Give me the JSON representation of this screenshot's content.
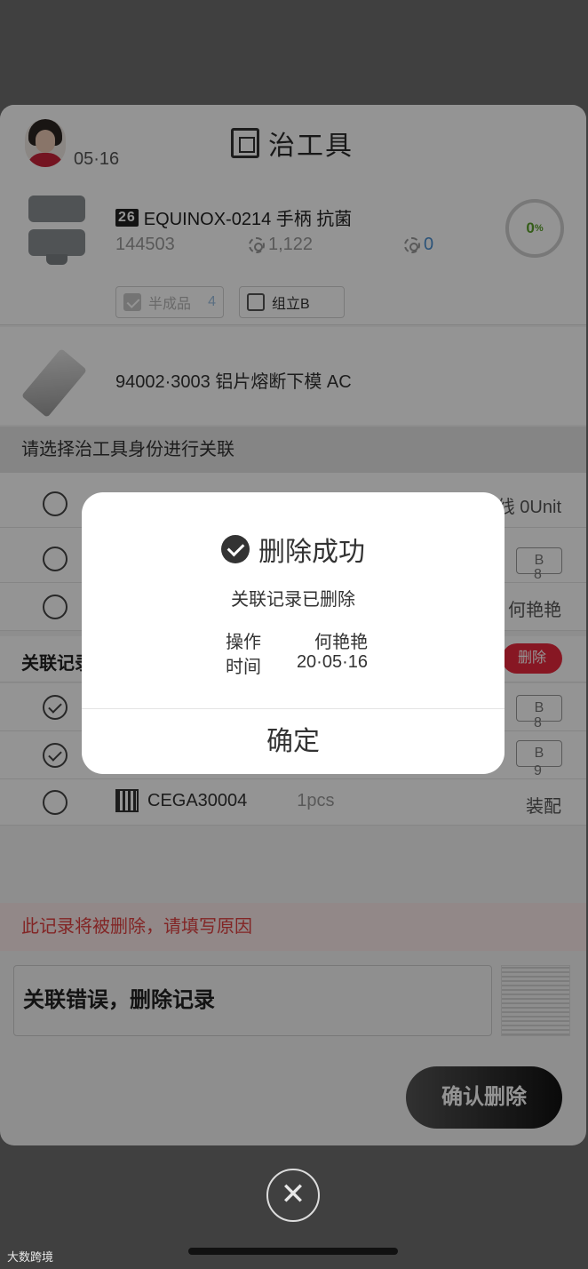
{
  "header": {
    "date": "05·16",
    "title": "治工具"
  },
  "product": {
    "code_badge": "26",
    "name": "EQUINOX-0214 手柄 抗菌",
    "id": "144503",
    "count_a": "1,122",
    "count_b": "0",
    "progress": "0",
    "progress_unit": "%",
    "tags": [
      {
        "label": "半成品",
        "count": "4",
        "checked": true
      },
      {
        "label": "组立B",
        "checked": false
      }
    ]
  },
  "tool": {
    "name": "94002·3003 铝片熔断下模 AC"
  },
  "select_section": {
    "title": "请选择治工具身份进行关联",
    "rows": [
      {
        "right": "线 0Unit"
      },
      {
        "tag": "B",
        "sub": "8"
      },
      {
        "right": "何艳艳"
      }
    ]
  },
  "linked_section": {
    "title": "关联记录",
    "delete_label": "删除",
    "rows": [
      {
        "tag": "B",
        "sub": "8",
        "checked": true
      },
      {
        "tag": "B",
        "sub": "9",
        "checked": true
      },
      {
        "code": "CEGA30004",
        "qty": "1pcs",
        "right": "装配",
        "checked": false
      }
    ]
  },
  "delete_form": {
    "warning": "此记录将被删除，请填写原因",
    "reason": "关联错误，删除记录",
    "confirm_label": "确认删除"
  },
  "modal": {
    "title": "删除成功",
    "message": "关联记录已删除",
    "operator_label": "操作",
    "operator_value": "何艳艳",
    "time_label": "时间",
    "time_value": "20·05·16",
    "ok_label": "确定"
  },
  "footer": {
    "close_symbol": "✕",
    "watermark": "大数跨境"
  },
  "colors": {
    "accent_red": "#e8283d",
    "progress_green": "#5aa12a",
    "warning_text": "#e04040"
  }
}
